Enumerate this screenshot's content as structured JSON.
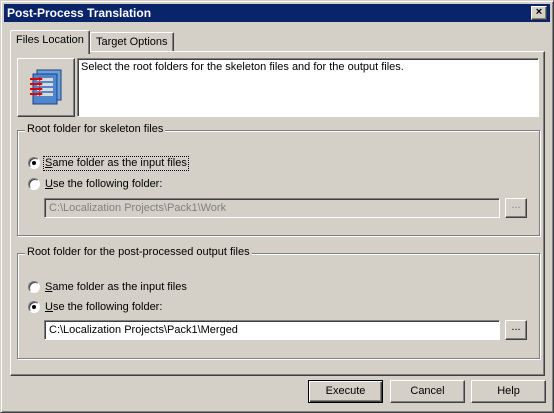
{
  "window": {
    "title": "Post-Process Translation",
    "close_label": "×"
  },
  "tabs": [
    {
      "label": "Files Location",
      "active": true
    },
    {
      "label": "Target Options",
      "active": false
    }
  ],
  "description": "Select the root folders for the skeleton files and for the output files.",
  "icon": "file-conversion-icon",
  "skeleton_group": {
    "label": "Root folder for skeleton files",
    "option_same_prefix": "S",
    "option_same_rest": "ame folder as the input files",
    "option_use_prefix": "U",
    "option_use_rest": "se the following folder:",
    "selected": "same",
    "path": "C:\\Localization Projects\\Pack1\\Work",
    "browse_label": "..."
  },
  "output_group": {
    "label": "Root folder for the post-processed output files",
    "option_same_prefix": "S",
    "option_same_rest": "ame folder as the input files",
    "option_use_prefix": "U",
    "option_use_rest": "se the following folder:",
    "selected": "use",
    "path": "C:\\Localization Projects\\Pack1\\Merged",
    "browse_label": "..."
  },
  "buttons": {
    "execute": "Execute",
    "cancel": "Cancel",
    "help": "Help"
  },
  "colors": {
    "titlebar": "#0a246a",
    "dialog_face": "#d4d0c8"
  }
}
